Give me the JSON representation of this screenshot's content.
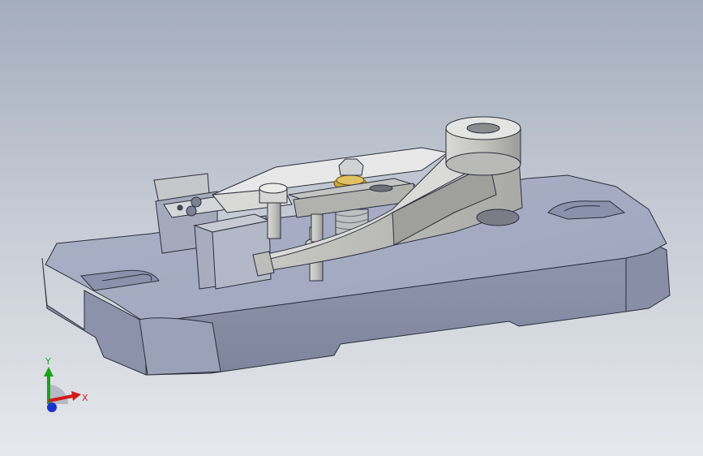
{
  "viewport": {
    "background_top": "#a4adbd",
    "background_bottom": "#e6e8ec",
    "model": "fixture-assembly",
    "shading": "shaded-with-edges"
  },
  "triad": {
    "x_label": "X",
    "y_label": "Y",
    "x_color": "#d11a1a",
    "y_color": "#19a319",
    "z_color": "#1a33cc"
  }
}
